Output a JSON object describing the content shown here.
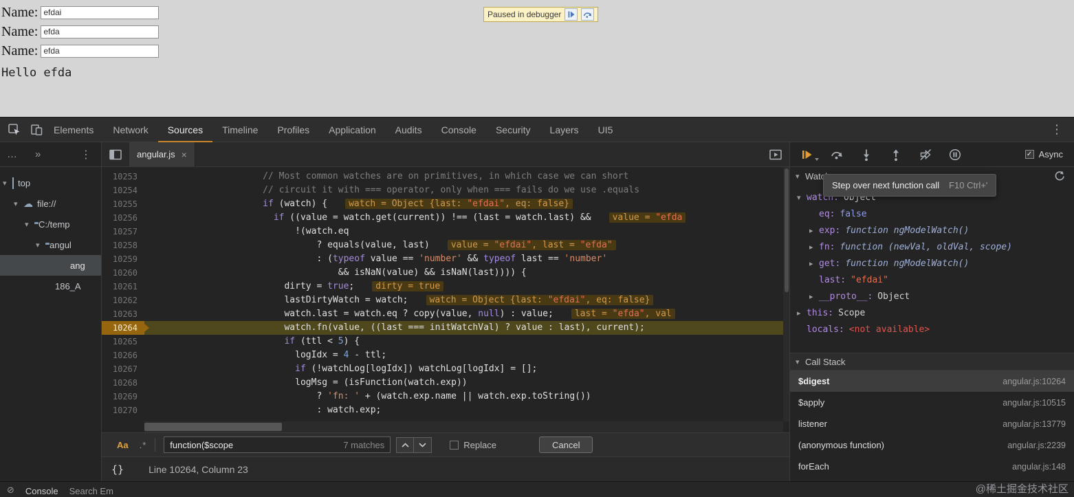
{
  "page": {
    "fields": [
      {
        "label": "Name:",
        "value": "efdai"
      },
      {
        "label": "Name:",
        "value": "efda"
      },
      {
        "label": "Name:",
        "value": "efda"
      }
    ],
    "hello": "Hello efda",
    "paused_text": "Paused in debugger"
  },
  "colors": {
    "accent_tab_underline": "#c8882a",
    "exec_line_bg": "#4e481c",
    "inline_widget_bg": "#4a3a13",
    "paused_banner_bg": "#fdf2c5"
  },
  "devtools": {
    "main_tabs": [
      {
        "label": "Elements",
        "active": false
      },
      {
        "label": "Network",
        "active": false
      },
      {
        "label": "Sources",
        "active": true
      },
      {
        "label": "Timeline",
        "active": false
      },
      {
        "label": "Profiles",
        "active": false
      },
      {
        "label": "Application",
        "active": false
      },
      {
        "label": "Audits",
        "active": false
      },
      {
        "label": "Console",
        "active": false
      },
      {
        "label": "Security",
        "active": false
      },
      {
        "label": "Layers",
        "active": false
      },
      {
        "label": "UI5",
        "active": false
      }
    ],
    "main_menu_glyph": "⋮",
    "navigator": {
      "toolbar": {
        "overflow": "…",
        "chevrons": "»",
        "menu": "⋮"
      },
      "items": [
        {
          "label": "top",
          "icon": "frame",
          "indent": 4,
          "arrow": "v",
          "selected": false
        },
        {
          "label": "file://",
          "icon": "cloud",
          "indent": 20,
          "arrow": "v",
          "selected": false
        },
        {
          "label": "C:/temp",
          "icon": "folder",
          "indent": 36,
          "arrow": "v",
          "selected": false
        },
        {
          "label": "angul",
          "icon": "folder",
          "indent": 52,
          "arrow": "v",
          "selected": false
        },
        {
          "label": "ang",
          "icon": "file",
          "indent": 96,
          "arrow": "",
          "selected": true
        },
        {
          "label": "186_A",
          "icon": "file",
          "indent": 74,
          "arrow": "",
          "selected": false
        }
      ]
    },
    "editor": {
      "tab": "angular.js",
      "tab_close": "×",
      "lines": [
        {
          "n": "10253",
          "ind": 22,
          "seg": [
            [
              "// Most common watches are on primitives, in which case we can short",
              "cm"
            ]
          ]
        },
        {
          "n": "10254",
          "ind": 22,
          "seg": [
            [
              "// circuit it with === operator, only when === fails do we use .equals",
              "cm"
            ]
          ]
        },
        {
          "n": "10255",
          "ind": 22,
          "seg": [
            [
              "if",
              "kw"
            ],
            [
              " (watch) {",
              "d"
            ]
          ],
          "w": [
            [
              "watch = Object {last: ",
              "wd"
            ],
            [
              "\"efdai\"",
              "ws"
            ],
            [
              ", eq: false}",
              "wd"
            ]
          ]
        },
        {
          "n": "10256",
          "ind": 24,
          "seg": [
            [
              "if",
              "kw"
            ],
            [
              " ((value = watch.get(current)) !== (last = watch.last) &&",
              "d"
            ]
          ],
          "w": [
            [
              "value = ",
              "wd"
            ],
            [
              "\"efda",
              "ws"
            ]
          ]
        },
        {
          "n": "10257",
          "ind": 28,
          "seg": [
            [
              "!(watch.eq",
              "d"
            ]
          ]
        },
        {
          "n": "10258",
          "ind": 32,
          "seg": [
            [
              "? equals(value, last)",
              "d"
            ]
          ],
          "w": [
            [
              "value = ",
              "wd"
            ],
            [
              "\"efdai\"",
              "ws"
            ],
            [
              ", last = ",
              "wd"
            ],
            [
              "\"efda\"",
              "ws"
            ]
          ]
        },
        {
          "n": "10259",
          "ind": 32,
          "seg": [
            [
              ": (",
              "d"
            ],
            [
              "typeof",
              "kw"
            ],
            [
              " value == ",
              "d"
            ],
            [
              "'number'",
              "str"
            ],
            [
              " && ",
              "d"
            ],
            [
              "typeof",
              "kw"
            ],
            [
              " last == ",
              "d"
            ],
            [
              "'number'",
              "str"
            ]
          ]
        },
        {
          "n": "10260",
          "ind": 36,
          "seg": [
            [
              "&& isNaN(value) && isNaN(last)))) {",
              "d"
            ]
          ]
        },
        {
          "n": "10261",
          "ind": 26,
          "seg": [
            [
              "dirty = ",
              "d"
            ],
            [
              "true",
              "kw"
            ],
            [
              ";",
              "d"
            ]
          ],
          "w": [
            [
              "dirty = true",
              "wd"
            ]
          ]
        },
        {
          "n": "10262",
          "ind": 26,
          "seg": [
            [
              "lastDirtyWatch = watch;",
              "d"
            ]
          ],
          "w": [
            [
              "watch = Object {last: ",
              "wd"
            ],
            [
              "\"efdai\"",
              "ws"
            ],
            [
              ", eq: false}",
              "wd"
            ]
          ]
        },
        {
          "n": "10263",
          "ind": 26,
          "seg": [
            [
              "watch.last = watch.eq ? copy(value, ",
              "d"
            ],
            [
              "null",
              "kw"
            ],
            [
              ") : value;",
              "d"
            ]
          ],
          "w": [
            [
              "last = ",
              "wd"
            ],
            [
              "\"efda\"",
              "ws"
            ],
            [
              ", val",
              "wd"
            ]
          ]
        },
        {
          "n": "10264",
          "ind": 26,
          "exec": true,
          "seg": [
            [
              "watch.fn(value, ((last === initWatchVal) ? value : last), current);",
              "d"
            ]
          ]
        },
        {
          "n": "10265",
          "ind": 26,
          "seg": [
            [
              "if",
              "kw"
            ],
            [
              " (ttl < ",
              "d"
            ],
            [
              "5",
              "num"
            ],
            [
              ") {",
              "d"
            ]
          ]
        },
        {
          "n": "10266",
          "ind": 28,
          "seg": [
            [
              "logIdx = ",
              "d"
            ],
            [
              "4",
              "num"
            ],
            [
              " - ttl;",
              "d"
            ]
          ]
        },
        {
          "n": "10267",
          "ind": 28,
          "seg": [
            [
              "if",
              "kw"
            ],
            [
              " (!watchLog[logIdx]) watchLog[logIdx] = [];",
              "d"
            ]
          ]
        },
        {
          "n": "10268",
          "ind": 28,
          "seg": [
            [
              "logMsg = (isFunction(watch.exp))",
              "d"
            ]
          ]
        },
        {
          "n": "10269",
          "ind": 32,
          "seg": [
            [
              "? ",
              "d"
            ],
            [
              "'fn: '",
              "str"
            ],
            [
              " + (watch.exp.name || watch.exp.toString())",
              "d"
            ]
          ]
        },
        {
          "n": "10270",
          "ind": 32,
          "seg": [
            [
              ": watch.exp;",
              "d"
            ]
          ]
        }
      ],
      "search": {
        "case_toggle": "Aa",
        "regex_toggle": ".*",
        "query": "function($scope",
        "matches": "7 matches",
        "replace_label": "Replace",
        "cancel_label": "Cancel"
      },
      "status": {
        "braces": "{}",
        "position": "Line 10264, Column 23"
      }
    },
    "debugger": {
      "async_label": "Async",
      "tooltip": {
        "label": "Step over next function call",
        "keys": "F10 Ctrl+'"
      },
      "watch": {
        "title": "Watch",
        "items": [
          {
            "indent": 0,
            "arrow": "v",
            "name": "watch:",
            "value": "Object",
            "cls": "v-plain"
          },
          {
            "indent": 1,
            "arrow": "",
            "name": "eq:",
            "value": "false",
            "cls": "v-bool"
          },
          {
            "indent": 1,
            "arrow": "r",
            "name": "exp:",
            "value": "function ngModelWatch()",
            "cls": "v-func"
          },
          {
            "indent": 1,
            "arrow": "r",
            "name": "fn:",
            "value": "function (newVal, oldVal, scope)",
            "cls": "v-func"
          },
          {
            "indent": 1,
            "arrow": "r",
            "name": "get:",
            "value": "function ngModelWatch()",
            "cls": "v-func"
          },
          {
            "indent": 1,
            "arrow": "",
            "name": "last:",
            "value": "\"efdai\"",
            "cls": "v-str"
          },
          {
            "indent": 1,
            "arrow": "r",
            "name": "__proto__:",
            "value": "Object",
            "cls": "v-plain"
          },
          {
            "indent": 0,
            "arrow": "r",
            "name": "this:",
            "value": "Scope",
            "cls": "v-plain"
          },
          {
            "indent": 0,
            "arrow": "",
            "name": "locals:",
            "value": "<not available>",
            "cls": "v-err"
          }
        ]
      },
      "callstack": {
        "title": "Call Stack",
        "frames": [
          {
            "name": "$digest",
            "loc": "angular.js:10264",
            "selected": true
          },
          {
            "name": "$apply",
            "loc": "angular.js:10515",
            "selected": false
          },
          {
            "name": "listener",
            "loc": "angular.js:13779",
            "selected": false
          },
          {
            "name": "(anonymous function)",
            "loc": "angular.js:2239",
            "selected": false
          },
          {
            "name": "forEach",
            "loc": "angular.js:148",
            "selected": false
          }
        ]
      }
    },
    "drawer": {
      "clear_glyph": "⊘",
      "tabs": [
        "Console",
        "Search Em"
      ]
    }
  },
  "watermark": "@稀土掘金技术社区"
}
